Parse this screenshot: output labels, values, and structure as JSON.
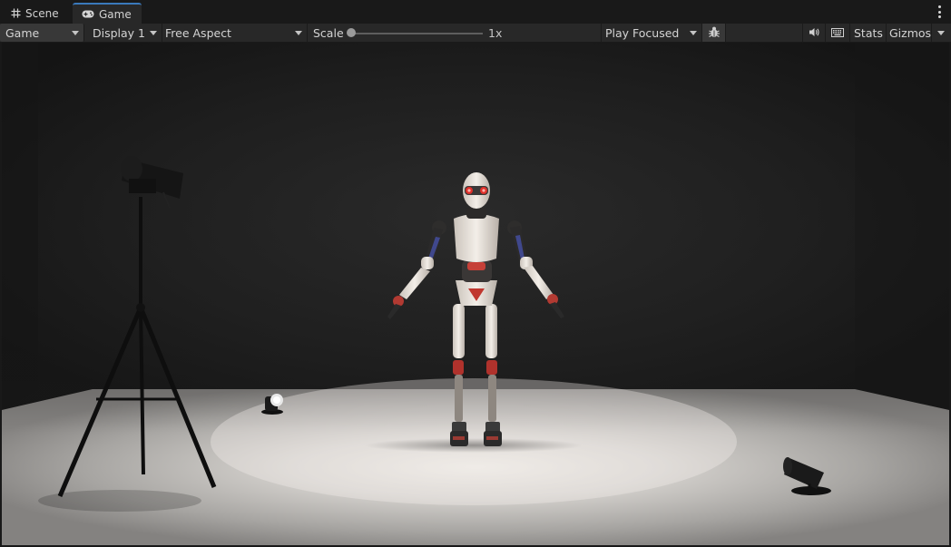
{
  "tabs": {
    "scene_label": "Scene",
    "game_label": "Game"
  },
  "toolbar": {
    "view_mode": "Game",
    "display": "Display 1",
    "aspect": "Free Aspect",
    "scale_label": "Scale",
    "scale_value": "1x",
    "play_mode": "Play Focused",
    "stats_label": "Stats",
    "gizmos_label": "Gizmos"
  },
  "icons": {
    "scene_tab": "grid-icon",
    "game_tab": "gamepad-icon",
    "debug": "bug-icon",
    "audio": "speaker-icon",
    "keyboard": "keyboard-icon",
    "more": "kebab-menu-icon"
  },
  "colors": {
    "accent": "#3a79bb",
    "panel": "#282828",
    "background": "#191919"
  }
}
